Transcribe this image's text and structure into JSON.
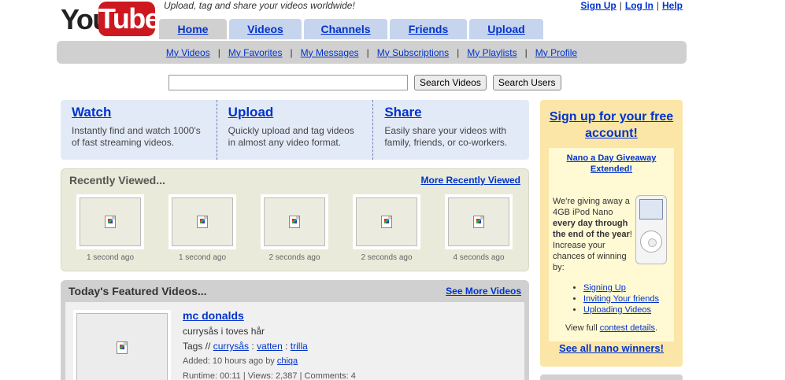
{
  "header": {
    "logo_text_you": "You",
    "logo_text_tube": "Tube",
    "tagline": "Upload, tag and share your videos worldwide!",
    "toplinks": [
      "Sign Up",
      "Log In",
      "Help"
    ],
    "tabs": [
      {
        "label": "Home",
        "active": true
      },
      {
        "label": "Videos",
        "active": false
      },
      {
        "label": "Channels",
        "active": false
      },
      {
        "label": "Friends",
        "active": false
      },
      {
        "label": "Upload",
        "active": false
      }
    ],
    "subnav": [
      "My Videos",
      "My Favorites",
      "My Messages",
      "My Subscriptions",
      "My Playlists",
      "My Profile"
    ],
    "subnav_separator": "|"
  },
  "search": {
    "value": "",
    "search_videos_label": "Search Videos",
    "search_users_label": "Search Users"
  },
  "intro": [
    {
      "title": "Watch",
      "text": "Instantly find and watch 1000's of fast streaming videos."
    },
    {
      "title": "Upload",
      "text": "Quickly upload and tag videos in almost any video format."
    },
    {
      "title": "Share",
      "text": "Easily share your videos with family, friends, or co-workers."
    }
  ],
  "recent": {
    "title": "Recently Viewed...",
    "more_link": "More Recently Viewed",
    "items": [
      "1 second ago",
      "1 second ago",
      "2 seconds ago",
      "2 seconds ago",
      "4 seconds ago"
    ]
  },
  "featured": {
    "title": "Today's Featured Videos...",
    "more_link": "See More Videos",
    "video": {
      "title": "mc donalds",
      "description": "currysås i toves hår",
      "tags_label": "Tags //",
      "tags": [
        "currysås",
        "vatten",
        "trilla"
      ],
      "added_label": "Added: 10 hours ago by",
      "added_by": "chiqa",
      "runtime": "Runtime: 00:11 | Views: 2,387 | Comments: 4"
    }
  },
  "promo": {
    "signup": "Sign up for your free account!",
    "giveaway_title": "Nano a Day Giveaway Extended!",
    "text_before": "We're giving away a 4GB iPod Nano ",
    "text_bold": "every day through the end of the year",
    "text_after": "! Increase your chances of winning by:",
    "links": [
      "Signing Up",
      "Inviting Your friends",
      "Uploading Videos"
    ],
    "contest_prefix": "View full ",
    "contest_link": "contest details",
    "contest_suffix": ".",
    "winners": "See all nano winners!"
  }
}
